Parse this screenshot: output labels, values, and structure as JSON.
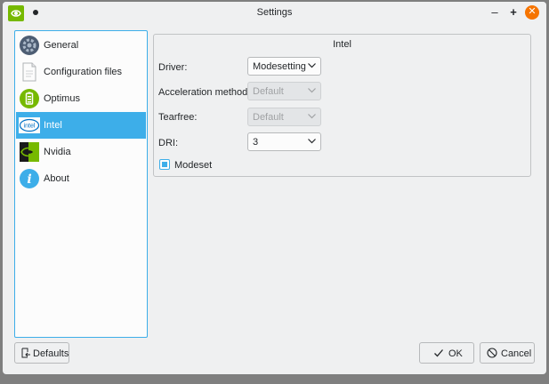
{
  "window": {
    "title": "Settings",
    "minimize_label": "–",
    "maximize_label": "+",
    "close_label": "✕"
  },
  "sidebar": {
    "items": [
      {
        "label": "General",
        "icon": "gear-icon"
      },
      {
        "label": "Configuration files",
        "icon": "document-icon"
      },
      {
        "label": "Optimus",
        "icon": "battery-icon"
      },
      {
        "label": "Intel",
        "icon": "intel-logo-icon",
        "icon_text": "intel"
      },
      {
        "label": "Nvidia",
        "icon": "nvidia-logo-icon"
      },
      {
        "label": "About",
        "icon": "info-icon",
        "icon_text": "i"
      }
    ],
    "selected_index": 3
  },
  "intel": {
    "title": "Intel",
    "driver_label": "Driver:",
    "driver_value": "Modesetting",
    "accel_label": "Acceleration method:",
    "accel_value": "Default",
    "tearfree_label": "Tearfree:",
    "tearfree_value": "Default",
    "dri_label": "DRI:",
    "dri_value": "3",
    "modeset_label": "Modeset",
    "modeset_checked": true
  },
  "footer": {
    "defaults_label": "Defaults",
    "ok_label": "OK",
    "cancel_label": "Cancel"
  },
  "colors": {
    "accent": "#3daee9",
    "nvidia_green": "#76b900",
    "close_orange": "#f67400",
    "window_bg": "#eff0f1"
  }
}
